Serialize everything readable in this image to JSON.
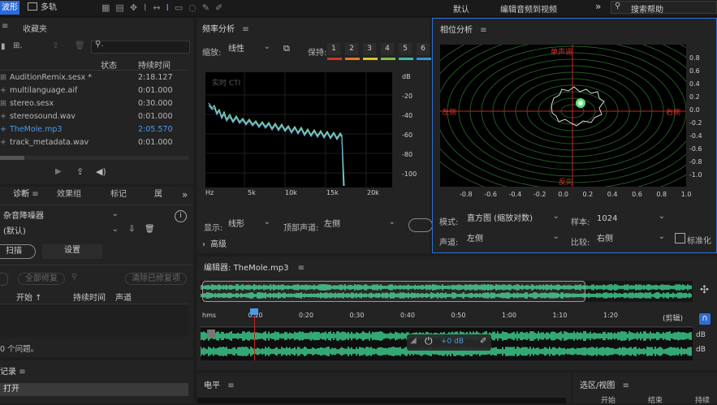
{
  "toolbar": {
    "waveform": "波形",
    "multitrack": "多轨",
    "workspace_default": "默认",
    "workspace_edit_video": "编辑音频到视频",
    "more": "»",
    "search_placeholder": "搜索帮助"
  },
  "files": {
    "tab": "收藏夹",
    "col_status": "状态",
    "col_duration": "持续时间",
    "search_icon": "search-icon",
    "items": [
      {
        "name": "AuditionRemix.sesx *",
        "duration": "2:18.127",
        "selected": false
      },
      {
        "name": "multilanguage.aif",
        "duration": "0:01.000",
        "selected": false
      },
      {
        "name": "stereo.sesx",
        "duration": "0:30.000",
        "selected": false
      },
      {
        "name": "stereosound.wav",
        "duration": "0:01.000",
        "selected": false
      },
      {
        "name": "TheMole.mp3",
        "duration": "2:05.570",
        "selected": true
      },
      {
        "name": "track_metadata.wav",
        "duration": "0:01.000",
        "selected": false
      }
    ]
  },
  "diag": {
    "tabs": [
      "诊断",
      "效果组",
      "标记",
      "属"
    ],
    "more": "»",
    "effect": "杂音降噪器",
    "preset": "(默认)",
    "scan": "扫描",
    "settings": "设置",
    "all_repair": "全部修复",
    "clear_repaired": "清除已修复项",
    "col_start": "开始 ↑",
    "col_duration": "持续时间",
    "col_channel": "声道",
    "status": "0 个问题。"
  },
  "history": {
    "title": "记录",
    "item": "打开"
  },
  "freq": {
    "title": "频率分析",
    "scale_label": "缩放:",
    "scale_value": "线性",
    "hold_label": "保持:",
    "hold_buttons": [
      "1",
      "2",
      "3",
      "4",
      "5",
      "6"
    ],
    "hold_colors": [
      "#d0342c",
      "#e07a22",
      "#d6c22a",
      "#7bc043",
      "#3fb6a8",
      "#3a8fd6"
    ],
    "realtime": "实时 CTI",
    "db_unit": "dB",
    "db_ticks": [
      "-20",
      "-40",
      "-60",
      "-80",
      "-100"
    ],
    "x_ticks": [
      "Hz",
      "5k",
      "10k",
      "15k",
      "20k"
    ],
    "display_label": "显示:",
    "display_value": "线形",
    "top_channel_label": "顶部声道:",
    "top_channel_value": "左侧",
    "advanced": "高级"
  },
  "phase": {
    "title": "相位分析",
    "top_label": "单声道",
    "left_label": "左侧",
    "right_label": "右侧",
    "bottom_label": "反向",
    "x_ticks": [
      "-0.8",
      "-0.6",
      "-0.4",
      "-0.2",
      "0.0",
      "0.2",
      "0.4",
      "0.6",
      "0.8",
      "1.0"
    ],
    "y_ticks": [
      "0.8",
      "0.6",
      "0.4",
      "0.2",
      "0.0",
      "-0.2",
      "-0.4",
      "-0.6",
      "-0.8",
      "-1.0"
    ],
    "mode_label": "模式:",
    "mode_value": "直方图 (缩放对数)",
    "sample_label": "样本:",
    "sample_value": "1024",
    "channel_label": "声道:",
    "channel_value": "左侧",
    "compare_label": "比较:",
    "compare_value": "右侧",
    "normalize": "标准化"
  },
  "editor": {
    "title": "编辑器: TheMole.mp3",
    "time_ticks": [
      "hms",
      "0:10",
      "0:20",
      "0:30",
      "0:40",
      "0:50",
      "1:00",
      "1:10",
      "1:20"
    ],
    "clip_label": "(剪辑)",
    "db_label": "dB",
    "hud_value": "+0 dB",
    "wave_color": "#3ecf8e"
  },
  "levels": {
    "title": "电平"
  },
  "selection": {
    "title": "选区/视图",
    "col_start": "开始",
    "col_end": "结束",
    "col_duration": "持续"
  }
}
